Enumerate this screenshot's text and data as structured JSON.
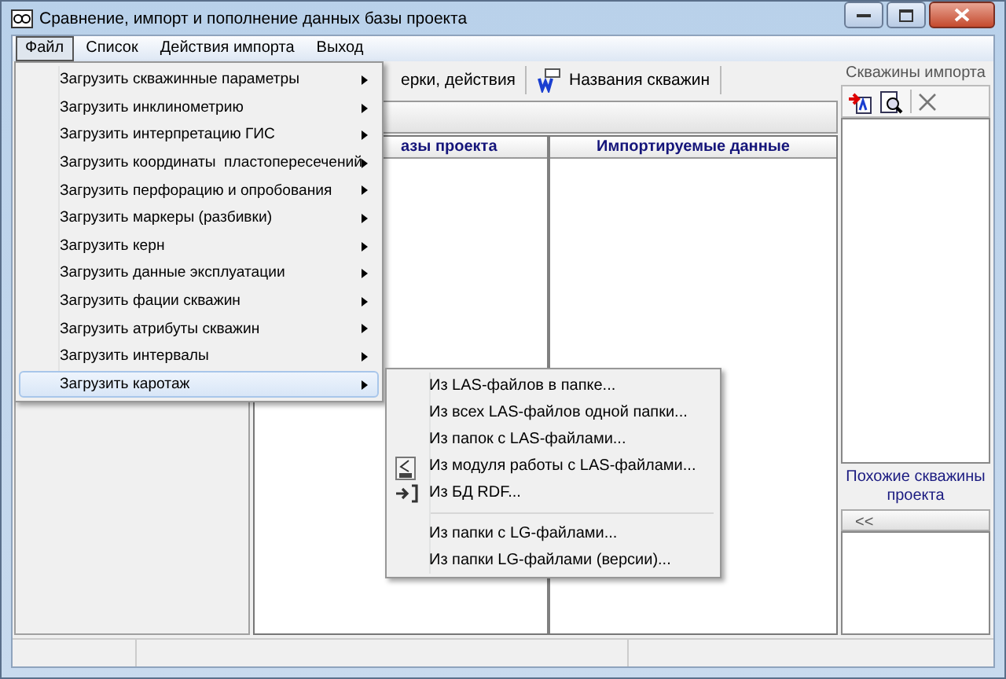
{
  "window": {
    "title": "Сравнение, импорт и пополнение данных базы проекта"
  },
  "menu_bar": [
    {
      "label": "Файл",
      "selected": true
    },
    {
      "label": "Список",
      "selected": false
    },
    {
      "label": "Действия импорта",
      "selected": false
    },
    {
      "label": "Выход",
      "selected": false
    }
  ],
  "tabs": [
    {
      "label": "ерки, действия",
      "kind": "plain"
    },
    {
      "label": "Названия скважин",
      "kind": "with_icon"
    }
  ],
  "table": {
    "columns": [
      "азы проекта",
      "Импортируемые данные"
    ]
  },
  "import_wells": {
    "title": "Скважины импорта"
  },
  "similar_wells": {
    "title": "Похожие скважины проекта",
    "button": "<<"
  },
  "file_menu": [
    {
      "label": "Загрузить скважинные параметры",
      "has_submenu": true,
      "selected": false
    },
    {
      "label": "Загрузить инклинометрию",
      "has_submenu": true,
      "selected": false
    },
    {
      "label": "Загрузить интерпретацию ГИС",
      "has_submenu": true,
      "selected": false
    },
    {
      "label": "Загрузить координаты  пластопересечений",
      "has_submenu": true,
      "selected": false
    },
    {
      "label": "Загрузить перфорацию и опробования",
      "has_submenu": true,
      "selected": false
    },
    {
      "label": "Загрузить маркеры (разбивки)",
      "has_submenu": true,
      "selected": false
    },
    {
      "label": "Загрузить керн",
      "has_submenu": true,
      "selected": false
    },
    {
      "label": "Загрузить данные эксплуатации",
      "has_submenu": true,
      "selected": false
    },
    {
      "label": "Загрузить фации скважин",
      "has_submenu": true,
      "selected": false
    },
    {
      "label": "Загрузить атрибуты скважин",
      "has_submenu": true,
      "selected": false
    },
    {
      "label": "Загрузить интервалы",
      "has_submenu": true,
      "selected": false
    },
    {
      "label": "Загрузить каротаж",
      "has_submenu": true,
      "selected": true
    }
  ],
  "submenu": [
    {
      "kind": "item",
      "label": "Из LAS-файлов в папке..."
    },
    {
      "kind": "item",
      "label": "Из всех LAS-файлов одной папки..."
    },
    {
      "kind": "item",
      "label": "Из папок с LAS-файлами..."
    },
    {
      "kind": "module_item",
      "label": "Из модуля работы с LAS-файлами..."
    },
    {
      "kind": "database_item",
      "label": "Из БД RDF..."
    },
    {
      "kind": "separator"
    },
    {
      "kind": "item",
      "label": "Из папки с LG-файлами..."
    },
    {
      "kind": "item",
      "label": "Из папки LG-файлами (версии)..."
    }
  ]
}
